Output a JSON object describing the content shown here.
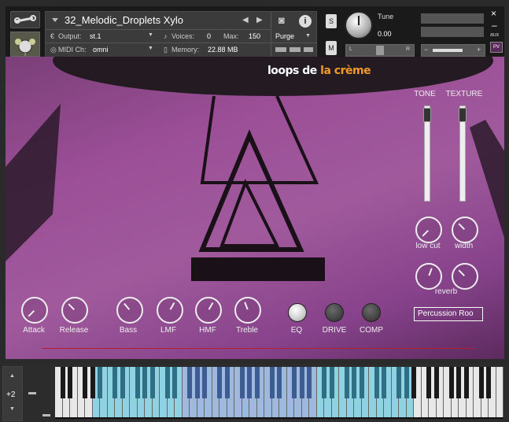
{
  "header": {
    "instrument_name": "32_Melodic_Droplets Xylo",
    "output_label": "Output:",
    "output_value": "st.1",
    "voices_label": "Voices:",
    "voices_value": "0",
    "max_label": "Max:",
    "max_value": "150",
    "purge_label": "Purge",
    "midi_label": "MIDI Ch:",
    "midi_value": "omni",
    "memory_label": "Memory:",
    "memory_value": "22.88 MB",
    "solo_label": "S",
    "mute_label": "M",
    "tune_label": "Tune",
    "tune_value": "0.00",
    "pan_left": "L",
    "pan_right": "R",
    "aux_label": "aux",
    "pv_label": "PV",
    "close_glyph": "×",
    "minimize_glyph": "–"
  },
  "panel": {
    "logo_part1": "loops de ",
    "logo_part2": "la crème",
    "tone_label": "TONE",
    "texture_label": "TEXTURE",
    "lowcut_label": "low cut",
    "width_label": "width",
    "reverb_label": "reverb",
    "reverb_preset": "Percussion Roo",
    "attack_label": "Attack",
    "release_label": "Release",
    "bass_label": "Bass",
    "lmf_label": "LMF",
    "hmf_label": "HMF",
    "treble_label": "Treble",
    "eq_label": "EQ",
    "drive_label": "DRIVE",
    "comp_label": "COMP"
  },
  "keyboard": {
    "octave_value": "+2"
  },
  "colors": {
    "accent_orange": "#f29a2a",
    "panel_purple": "#9c4f97",
    "key_blue": "#8fd3e3",
    "key_periwinkle": "#9eb8de"
  }
}
